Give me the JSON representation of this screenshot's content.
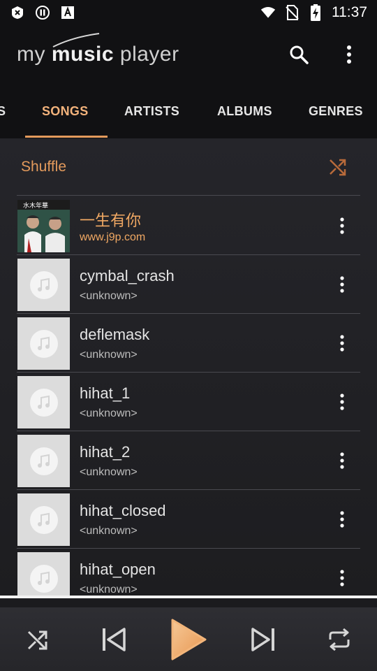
{
  "status_bar": {
    "time": "11:37",
    "icons": [
      "close-x-icon",
      "pause-icon",
      "font-icon",
      "wifi-icon",
      "no-sim-icon",
      "battery-charging-icon"
    ]
  },
  "app_bar": {
    "logo_part1": "my ",
    "logo_part2": "music",
    "logo_part3": " player",
    "actions": [
      "search-icon",
      "more-vert-icon"
    ]
  },
  "tabs": [
    {
      "label": "S",
      "active": false
    },
    {
      "label": "SONGS",
      "active": true
    },
    {
      "label": "ARTISTS",
      "active": false
    },
    {
      "label": "ALBUMS",
      "active": false
    },
    {
      "label": "GENRES",
      "active": false
    }
  ],
  "shuffle": {
    "label": "Shuffle",
    "icon": "shuffle-icon"
  },
  "songs": [
    {
      "title": "一生有你",
      "subtitle": "www.j9p.com",
      "art": "album-photo",
      "playing": true
    },
    {
      "title": "cymbal_crash",
      "subtitle": "<unknown>",
      "art": "music-note-icon",
      "playing": false
    },
    {
      "title": "deflemask",
      "subtitle": "<unknown>",
      "art": "music-note-icon",
      "playing": false
    },
    {
      "title": "hihat_1",
      "subtitle": "<unknown>",
      "art": "music-note-icon",
      "playing": false
    },
    {
      "title": "hihat_2",
      "subtitle": "<unknown>",
      "art": "music-note-icon",
      "playing": false
    },
    {
      "title": "hihat_closed",
      "subtitle": "<unknown>",
      "art": "music-note-icon",
      "playing": false
    },
    {
      "title": "hihat_open",
      "subtitle": "<unknown>",
      "art": "music-note-icon",
      "playing": false
    }
  ],
  "player": {
    "controls": [
      "shuffle-icon",
      "skip-previous-icon",
      "play-icon",
      "skip-next-icon",
      "repeat-icon"
    ],
    "progress": 0.0
  },
  "colors": {
    "accent": "#e39a5c",
    "playing_text": "#f0a863",
    "background": "#1e1e21",
    "bar": "#111113"
  }
}
